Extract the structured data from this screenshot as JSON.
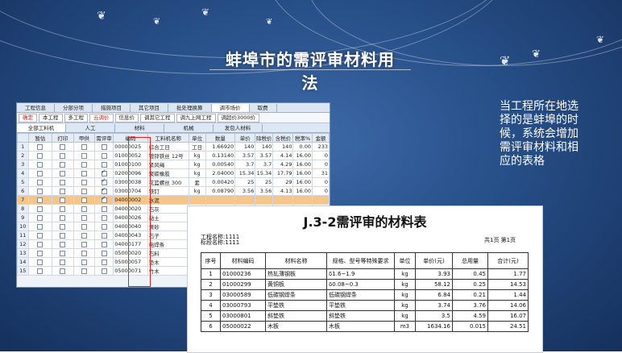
{
  "slide": {
    "title": "蚌埠市的需评审材料用法",
    "description": "当工程所在地选择的是蚌埠的时候，系统会增加需评审材料和相应的表格"
  },
  "software": {
    "top_tabs": [
      "工程信息",
      "分部分项",
      "措施项目",
      "其它项目",
      "批处理换算",
      "调市场价",
      "取费"
    ],
    "top_tab_active": "调市场价",
    "toolbar": [
      "确定",
      "本工程",
      "多工程",
      "云调价",
      "信息价",
      "调其它工程",
      "调九上网工程",
      "调超价3000价"
    ],
    "sub_tabs": [
      "全部工料机",
      "人工",
      "材料",
      "机械",
      "发包人材料"
    ],
    "sub_tab_active": "全部工料机",
    "columns": [
      "",
      "暂估",
      "打印",
      "甲供",
      "需评审",
      "编码",
      "工料机名称",
      "单位",
      "数量",
      "单价",
      "除税价",
      "含税价",
      "税率%",
      "金额"
    ],
    "rows": [
      {
        "n": "1",
        "zg": false,
        "dy": false,
        "jg": false,
        "ps": false,
        "code": "00000025",
        "name": "综合工日",
        "unit": "工日",
        "qty": "1.66920",
        "price": "140",
        "ex": "140",
        "inc": "140",
        "tax": "0.00",
        "amt": "233"
      },
      {
        "n": "2",
        "zg": false,
        "dy": false,
        "jg": false,
        "ps": false,
        "code": "01000052",
        "name": "镀锌铁丝 12号",
        "unit": "kg",
        "qty": "0.13140",
        "price": "3.57",
        "ex": "3.57",
        "inc": "4.14",
        "tax": "16.00",
        "amt": "0"
      },
      {
        "n": "3",
        "zg": false,
        "dy": false,
        "jg": false,
        "ps": false,
        "code": "01000100",
        "name": "紧风绳",
        "unit": "kg",
        "qty": "0.00540",
        "price": "3.7",
        "ex": "3.7",
        "inc": "4.29",
        "tax": "16.00",
        "amt": "0"
      },
      {
        "n": "4",
        "zg": false,
        "dy": false,
        "jg": false,
        "ps": true,
        "code": "02000096",
        "name": "聚碳橡胶",
        "unit": "kg",
        "qty": "2.04000",
        "price": "15.34",
        "ex": "15.34",
        "inc": "17.79",
        "tax": "16.00",
        "amt": "31"
      },
      {
        "n": "5",
        "zg": false,
        "dy": false,
        "jg": false,
        "ps": true,
        "code": "03000038",
        "name": "花篮螺丝 300",
        "unit": "套",
        "qty": "0.00420",
        "price": "25",
        "ex": "25",
        "inc": "29",
        "tax": "16.00",
        "amt": "0"
      },
      {
        "n": "6",
        "zg": false,
        "dy": false,
        "jg": false,
        "ps": true,
        "code": "03000704",
        "name": "铁钉",
        "unit": "kg",
        "qty": "0.08790",
        "price": "3.56",
        "ex": "3.56",
        "inc": "4.13",
        "tax": "16.00",
        "amt": "0"
      },
      {
        "n": "7",
        "zg": false,
        "dy": false,
        "jg": false,
        "ps": true,
        "code": "04000002",
        "name": "水泥",
        "unit": "",
        "qty": "",
        "price": "",
        "ex": "",
        "inc": "",
        "tax": "",
        "amt": "",
        "selected": true
      },
      {
        "n": "8",
        "zg": false,
        "dy": false,
        "jg": false,
        "ps": false,
        "code": "04000020",
        "name": "石灰",
        "unit": "",
        "qty": "",
        "price": "",
        "ex": "",
        "inc": "",
        "tax": "",
        "amt": ""
      },
      {
        "n": "9",
        "zg": false,
        "dy": false,
        "jg": false,
        "ps": false,
        "code": "04000026",
        "name": "黏土",
        "unit": "",
        "qty": "",
        "price": "",
        "ex": "",
        "inc": "",
        "tax": "",
        "amt": ""
      },
      {
        "n": "10",
        "zg": false,
        "dy": false,
        "jg": false,
        "ps": false,
        "code": "04000040",
        "name": "黄砂",
        "unit": "",
        "qty": "",
        "price": "",
        "ex": "",
        "inc": "",
        "tax": "",
        "amt": ""
      },
      {
        "n": "11",
        "zg": false,
        "dy": false,
        "jg": false,
        "ps": false,
        "code": "04000043",
        "name": "石子",
        "unit": "",
        "qty": "",
        "price": "",
        "ex": "",
        "inc": "",
        "tax": "",
        "amt": ""
      },
      {
        "n": "12",
        "zg": false,
        "dy": false,
        "jg": false,
        "ps": false,
        "code": "04000177",
        "name": "电焊条",
        "unit": "",
        "qty": "",
        "price": "",
        "ex": "",
        "inc": "",
        "tax": "",
        "amt": ""
      },
      {
        "n": "13",
        "zg": false,
        "dy": false,
        "jg": false,
        "ps": false,
        "code": "05000020",
        "name": "石料",
        "unit": "",
        "qty": "",
        "price": "",
        "ex": "",
        "inc": "",
        "tax": "",
        "amt": ""
      },
      {
        "n": "14",
        "zg": false,
        "dy": false,
        "jg": false,
        "ps": false,
        "code": "05000057",
        "name": "垫木",
        "unit": "",
        "qty": "",
        "price": "",
        "ex": "",
        "inc": "",
        "tax": "",
        "amt": ""
      },
      {
        "n": "15",
        "zg": false,
        "dy": false,
        "jg": false,
        "ps": false,
        "code": "05000071",
        "name": "竹木",
        "unit": "",
        "qty": "",
        "price": "",
        "ex": "",
        "inc": "",
        "tax": "",
        "amt": ""
      }
    ]
  },
  "report": {
    "title": "J.3-2需评审的材料表",
    "project_label": "工程名称:",
    "project_value": "1111",
    "section_label": "标段名称:",
    "section_value": "1111",
    "page_info": "共1页 第1页",
    "columns": [
      "序号",
      "材料编码",
      "材料名称",
      "规格、型号等特殊要求",
      "单位",
      "单价(元)",
      "总用量",
      "合计(元)"
    ],
    "rows": [
      {
        "no": "1",
        "code": "01000236",
        "name": "热轧薄钢板",
        "spec": "δ1.6~1.9",
        "unit": "kg",
        "price": "3.93",
        "qty": "0.45",
        "total": "1.77"
      },
      {
        "no": "2",
        "code": "01000299",
        "name": "黄铜板",
        "spec": "δ0.08~0.3",
        "unit": "kg",
        "price": "58.12",
        "qty": "0.25",
        "total": "14.53"
      },
      {
        "no": "3",
        "code": "03000589",
        "name": "低碳钢焊条",
        "spec": "低碳钢焊条",
        "unit": "kg",
        "price": "6.84",
        "qty": "0.21",
        "total": "1.44"
      },
      {
        "no": "4",
        "code": "03000793",
        "name": "平垫铁",
        "spec": "平垫铁",
        "unit": "kg",
        "price": "3.74",
        "qty": "3.76",
        "total": "14.06"
      },
      {
        "no": "5",
        "code": "03000801",
        "name": "斜垫铁",
        "spec": "斜垫铁",
        "unit": "kg",
        "price": "3.5",
        "qty": "4.59",
        "total": "16.07"
      },
      {
        "no": "6",
        "code": "05000022",
        "name": "木板",
        "spec": "木板",
        "unit": "m3",
        "price": "1634.16",
        "qty": "0.015",
        "total": "24.51"
      }
    ]
  }
}
